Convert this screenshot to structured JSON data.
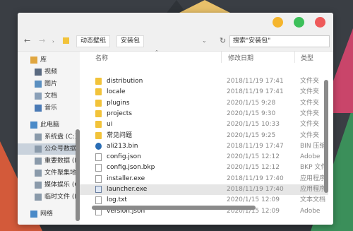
{
  "toolbar": {
    "crumbs": [
      "动态壁纸",
      "安装包"
    ],
    "search": "搜索\"安装包\""
  },
  "sidebar": {
    "items": [
      {
        "label": "库",
        "icon": "library-icon"
      },
      {
        "label": "视频",
        "icon": "video-icon"
      },
      {
        "label": "图片",
        "icon": "image-icon"
      },
      {
        "label": "文档",
        "icon": "document-icon"
      },
      {
        "label": "音乐",
        "icon": "music-icon"
      },
      {
        "label": "此电脑",
        "icon": "computer-icon"
      },
      {
        "label": "系统盘 (C:)",
        "icon": "drive-icon"
      },
      {
        "label": "公众号数据",
        "icon": "drive-icon"
      },
      {
        "label": "重要数据 (E",
        "icon": "drive-icon"
      },
      {
        "label": "文件聚集地",
        "icon": "drive-icon"
      },
      {
        "label": "媒体娱乐 (G",
        "icon": "drive-icon"
      },
      {
        "label": "临时文件 (H",
        "icon": "drive-icon"
      },
      {
        "label": "网络",
        "icon": "network-icon"
      }
    ],
    "selected_index": 7
  },
  "columns": {
    "name": "名称",
    "date": "修改日期",
    "type": "类型"
  },
  "files": [
    {
      "name": "distribution",
      "date": "2018/11/19 17:41",
      "type": "文件夹",
      "kind": "folder"
    },
    {
      "name": "locale",
      "date": "2018/11/19 17:41",
      "type": "文件夹",
      "kind": "folder"
    },
    {
      "name": "plugins",
      "date": "2020/1/15 9:28",
      "type": "文件夹",
      "kind": "folder"
    },
    {
      "name": "projects",
      "date": "2020/1/15 9:30",
      "type": "文件夹",
      "kind": "folder"
    },
    {
      "name": "ui",
      "date": "2020/1/15 10:33",
      "type": "文件夹",
      "kind": "folder"
    },
    {
      "name": "常见问题",
      "date": "2020/1/15 9:25",
      "type": "文件夹",
      "kind": "folder"
    },
    {
      "name": "ali213.bin",
      "date": "2018/11/19 17:47",
      "type": "BIN 压缩",
      "kind": "bin"
    },
    {
      "name": "config.json",
      "date": "2020/1/15 12:12",
      "type": "Adobe",
      "kind": "doc"
    },
    {
      "name": "config.json.bkp",
      "date": "2020/1/15 12:12",
      "type": "BKP 文件",
      "kind": "doc"
    },
    {
      "name": "installer.exe",
      "date": "2018/11/19 17:40",
      "type": "应用程序",
      "kind": "doc"
    },
    {
      "name": "launcher.exe",
      "date": "2018/11/19 17:40",
      "type": "应用程序",
      "kind": "app"
    },
    {
      "name": "log.txt",
      "date": "2020/1/15 12:09",
      "type": "文本文档",
      "kind": "doc"
    },
    {
      "name": "version.json",
      "date": "2020/1/15 12:09",
      "type": "Adobe",
      "kind": "doc"
    }
  ],
  "selected_file_index": 10,
  "colors": {
    "close": "#ee5a5a",
    "maximize": "#3dc05a",
    "minimize": "#f5b52d",
    "folder": "#f2c33a",
    "accent": "#2a6db5"
  }
}
